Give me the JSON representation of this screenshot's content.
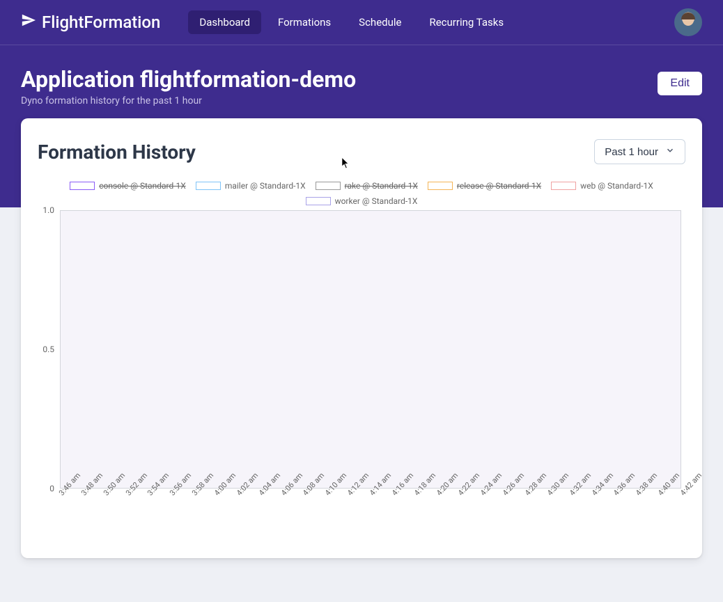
{
  "brand": "FlightFormation",
  "nav": {
    "items": [
      {
        "label": "Dashboard",
        "active": true
      },
      {
        "label": "Formations",
        "active": false
      },
      {
        "label": "Schedule",
        "active": false
      },
      {
        "label": "Recurring Tasks",
        "active": false
      }
    ]
  },
  "page": {
    "title": "Application flightformation-demo",
    "subtitle": "Dyno formation history for the past 1 hour",
    "edit_label": "Edit"
  },
  "card": {
    "title": "Formation History",
    "range_label": "Past 1 hour"
  },
  "chart_data": {
    "type": "line",
    "title": "Formation History",
    "xlabel": "",
    "ylabel": "",
    "ylim": [
      0,
      1
    ],
    "y_ticks": [
      "1.0",
      "0.5",
      "0"
    ],
    "categories": [
      "3:46 am",
      "3:48 am",
      "3:50 am",
      "3:52 am",
      "3:54 am",
      "3:56 am",
      "3:58 am",
      "4:00 am",
      "4:02 am",
      "4:04 am",
      "4:06 am",
      "4:08 am",
      "4:10 am",
      "4:12 am",
      "4:14 am",
      "4:16 am",
      "4:18 am",
      "4:20 am",
      "4:22 am",
      "4:24 am",
      "4:26 am",
      "4:28 am",
      "4:30 am",
      "4:32 am",
      "4:34 am",
      "4:36 am",
      "4:38 am",
      "4:40 am",
      "4:42 am"
    ],
    "series": [
      {
        "name": "console @ Standard-1X",
        "color": "#8b5cf6",
        "disabled": true,
        "values": [
          0,
          0,
          0,
          0,
          0,
          0,
          0,
          0,
          0,
          0,
          0,
          0,
          0,
          0,
          0,
          0,
          0,
          0,
          0,
          0,
          0,
          0,
          0,
          0,
          0,
          0,
          0,
          0,
          0
        ]
      },
      {
        "name": "mailer @ Standard-1X",
        "color": "#7fc4f8",
        "disabled": false,
        "values": [
          0,
          0,
          0,
          0,
          0,
          0,
          0,
          0,
          0,
          0,
          0,
          0,
          0,
          0,
          0,
          0,
          0,
          0,
          0,
          0,
          0,
          0,
          0,
          0,
          0,
          0,
          0,
          0,
          0
        ]
      },
      {
        "name": "rake @ Standard-1X",
        "color": "#999999",
        "disabled": true,
        "values": [
          0,
          0,
          0,
          0,
          0,
          0,
          0,
          0,
          0,
          0,
          0,
          0,
          0,
          0,
          0,
          0,
          0,
          0,
          0,
          0,
          0,
          0,
          0,
          0,
          0,
          0,
          0,
          0,
          0
        ]
      },
      {
        "name": "release @ Standard-1X",
        "color": "#f4b557",
        "disabled": true,
        "values": [
          0,
          0,
          0,
          0,
          0,
          0,
          0,
          0,
          0,
          0,
          0,
          0,
          0,
          0,
          0,
          0,
          0,
          0,
          0,
          0,
          0,
          0,
          0,
          0,
          0,
          0,
          0,
          0,
          0
        ]
      },
      {
        "name": "web @ Standard-1X",
        "color": "#f0a2a2",
        "disabled": false,
        "values": [
          0,
          0,
          0,
          0,
          0,
          0,
          0,
          0,
          0,
          0,
          0,
          0,
          0,
          0,
          0,
          0,
          0,
          0,
          0,
          0,
          0,
          0,
          0,
          0,
          0,
          0,
          0,
          0,
          0
        ]
      },
      {
        "name": "worker @ Standard-1X",
        "color": "#a9a2e8",
        "disabled": false,
        "values": [
          0,
          0,
          0,
          0,
          0,
          0,
          0,
          0,
          0,
          0,
          0,
          0,
          0,
          0,
          0,
          0,
          0,
          0,
          0,
          0,
          0,
          0,
          0,
          0,
          0,
          0,
          0,
          0,
          0
        ]
      }
    ]
  }
}
